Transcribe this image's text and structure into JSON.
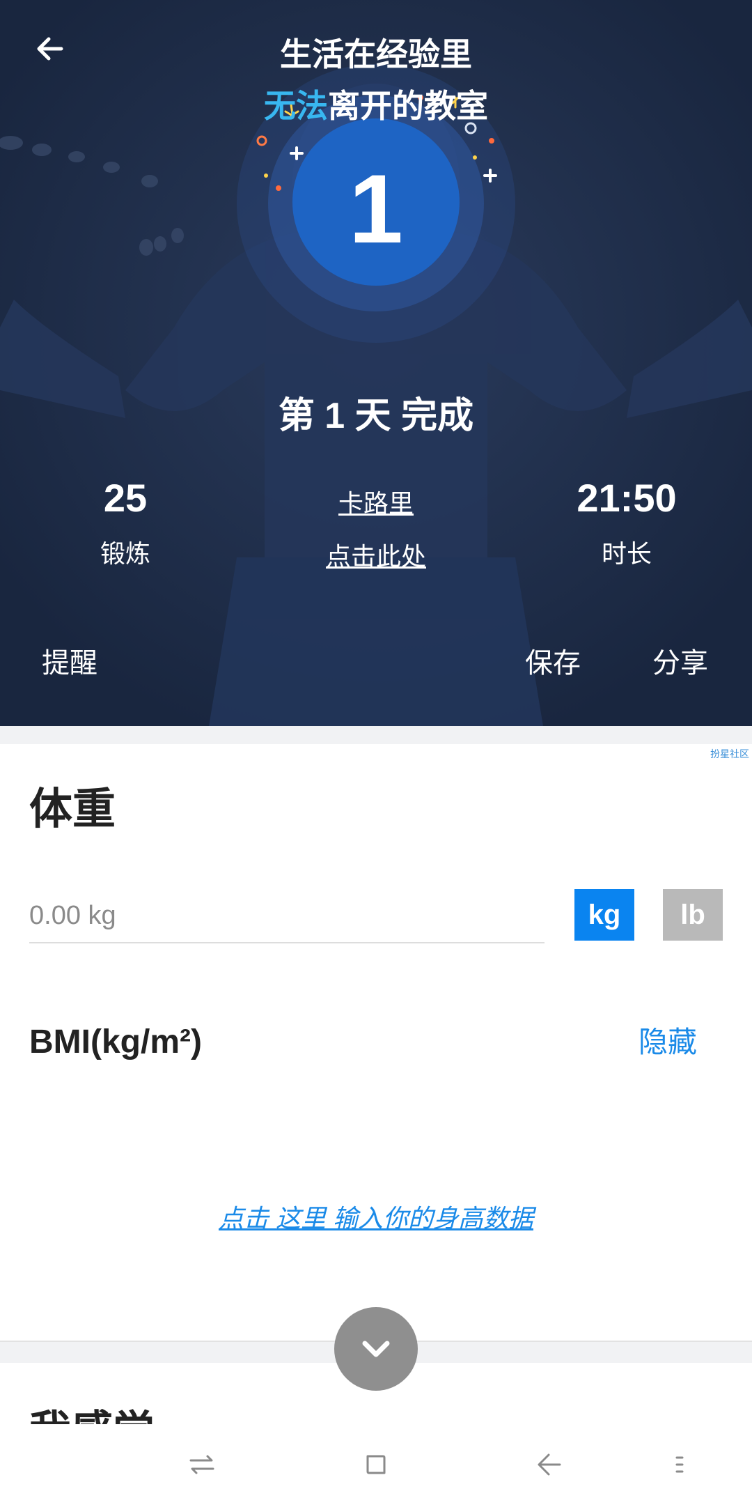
{
  "header": {
    "slogan_line1": "生活在经验里",
    "slogan_line2_highlight": "无法",
    "slogan_line2_rest": "离开的教室"
  },
  "badge": {
    "day_number": "1"
  },
  "summary": {
    "complete_text": "第 1 天 完成",
    "workouts_value": "25",
    "workouts_label": "锻炼",
    "calories_label": "卡路里",
    "calories_link": "点击此处",
    "duration_value": "21:50",
    "duration_label": "时长"
  },
  "actions": {
    "remind": "提醒",
    "save": "保存",
    "share": "分享"
  },
  "ad_tag": "扮星社区",
  "weight": {
    "title": "体重",
    "placeholder": "0.00 kg",
    "unit_kg": "kg",
    "unit_lb": "lb"
  },
  "bmi": {
    "title": "BMI(kg/m²)",
    "hide_label": "隐藏",
    "height_prompt": "点击 这里 输入你的身高数据"
  },
  "next_section": {
    "title": "我感觉"
  },
  "colors": {
    "hero_bg": "#1b2a47",
    "accent_blue": "#0a84f0",
    "link_blue": "#1a8ae8",
    "highlight_cyan": "#38b7f0",
    "unit_inactive": "#b9b9b9",
    "expand_button": "#8f8f8f"
  },
  "icons": {
    "back": "arrow-left-icon",
    "expand": "chevron-down-icon",
    "recents": "recent-apps-icon",
    "home": "home-square-icon",
    "nav_back": "nav-back-icon",
    "menu": "menu-dots-icon"
  }
}
